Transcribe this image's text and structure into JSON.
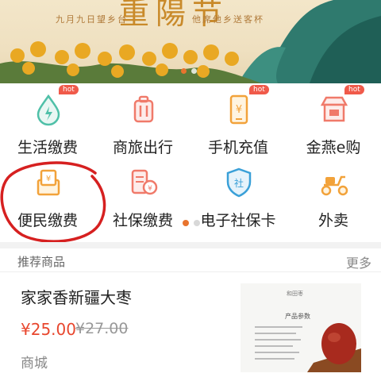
{
  "banner": {
    "title": "重陽节",
    "subtitle_left": "九月九日望乡台",
    "subtitle_right": "他席他乡送客杯"
  },
  "services": [
    {
      "label": "生活缴费",
      "icon": "water-drop-icon",
      "hot": true
    },
    {
      "label": "商旅出行",
      "icon": "suitcase-icon",
      "hot": false
    },
    {
      "label": "手机充值",
      "icon": "phone-icon",
      "hot": true
    },
    {
      "label": "金燕e购",
      "icon": "shop-icon",
      "hot": true
    },
    {
      "label": "便民缴费",
      "icon": "bill-icon",
      "hot": false
    },
    {
      "label": "社保缴费",
      "icon": "card-icon",
      "hot": false
    },
    {
      "label": "电子社保卡",
      "icon": "shield-icon",
      "hot": false
    },
    {
      "label": "外卖",
      "icon": "scooter-icon",
      "hot": false
    }
  ],
  "hot_badge": "hot",
  "recommend": {
    "title": "推荐商品",
    "more": "更多"
  },
  "product": {
    "name": "家家香新疆大枣",
    "price": "¥25.00",
    "old_price": "¥27.00",
    "shop": "商城",
    "thumb_title": "产品参数",
    "thumb_brand": "和田枣"
  },
  "colors": {
    "accent": "#e8742e",
    "price": "#e8472e",
    "annotation": "#d62020"
  }
}
